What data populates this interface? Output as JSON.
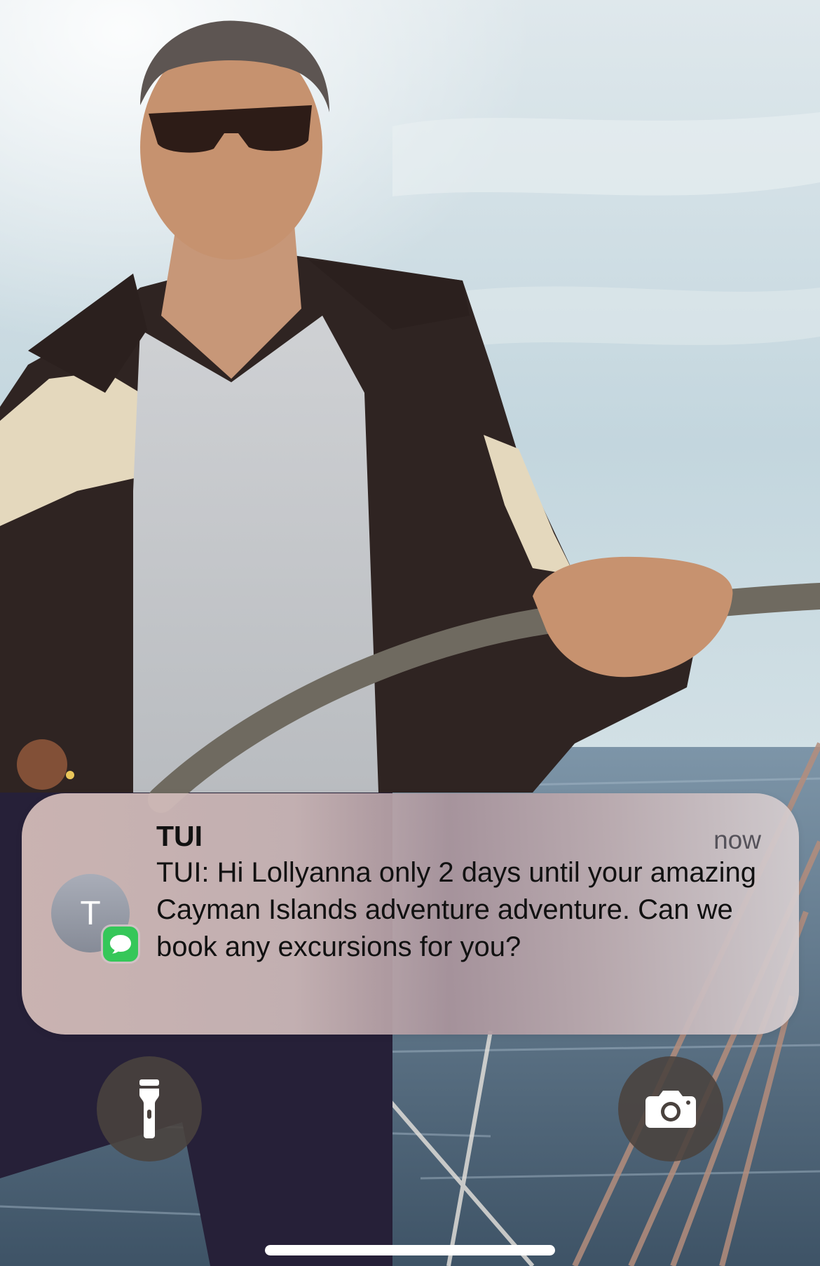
{
  "lock_screen": {
    "wallpaper": "man-steering-sailboat-photo",
    "home_indicator_color": "#ffffff"
  },
  "notification": {
    "avatar_initial": "T",
    "app_badge_icon": "messages-icon",
    "app_badge_color": "#35c759",
    "sender": "TUI",
    "time": "now",
    "body": "TUI: Hi Lollyanna only 2 days until your amazing Cayman Islands adventure adventure. Can we book any excursions for you?"
  },
  "quick_actions": {
    "left_icon": "flashlight-icon",
    "right_icon": "camera-icon"
  }
}
